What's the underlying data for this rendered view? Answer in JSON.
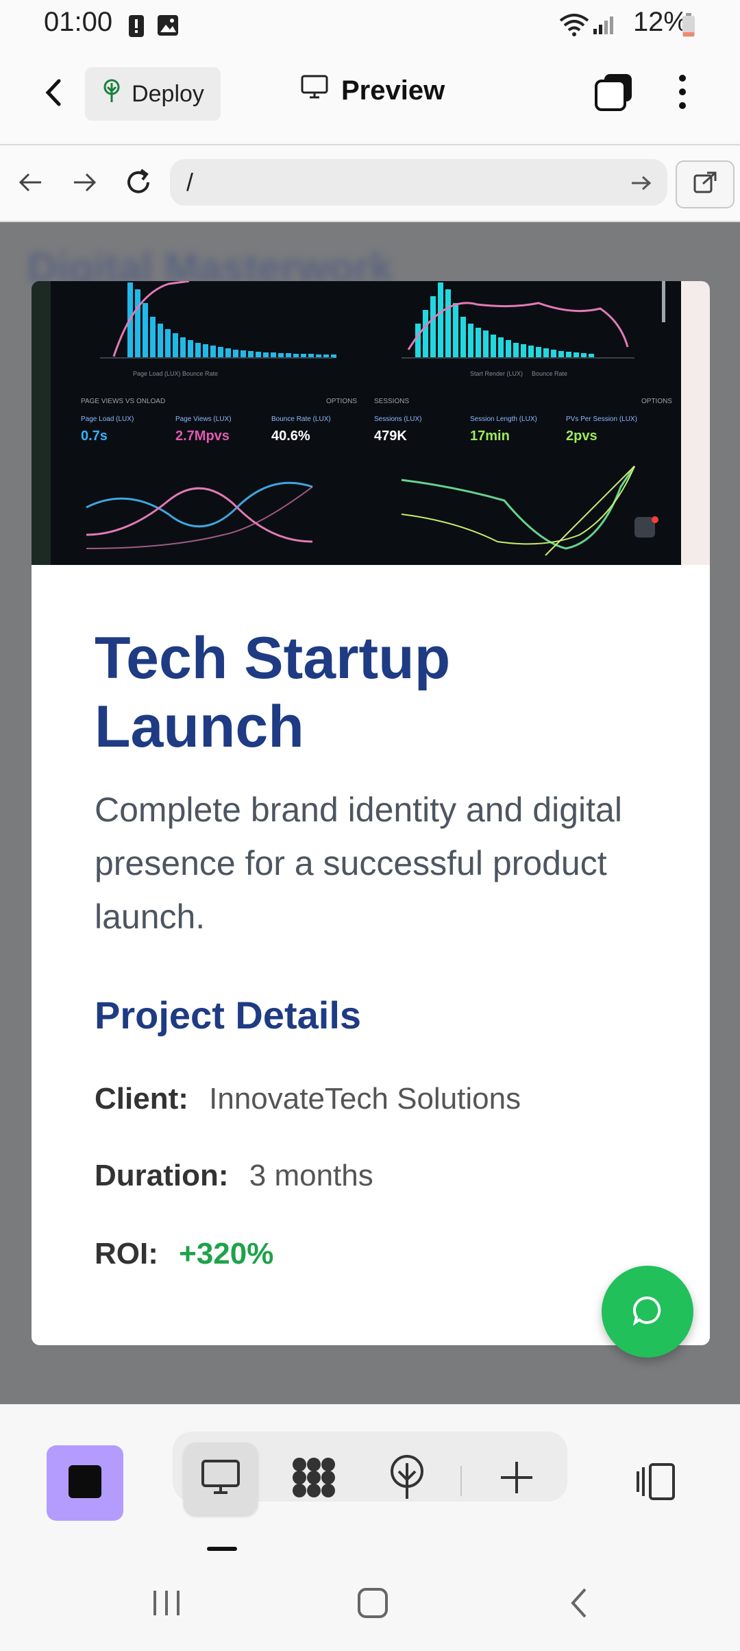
{
  "status_bar": {
    "time": "01:00",
    "battery": "12%",
    "icons": [
      "alert-icon",
      "image-icon",
      "wifi-icon",
      "signal-icon",
      "battery-icon"
    ]
  },
  "toolbar": {
    "deploy_label": "Deploy",
    "preview_label": "Preview",
    "icons": [
      "back-arrow-icon",
      "deploy-tree-icon",
      "monitor-icon",
      "window-stack-icon",
      "more-vert-icon"
    ]
  },
  "browser": {
    "url": "/",
    "icons": [
      "nav-back-icon",
      "nav-forward-icon",
      "refresh-icon",
      "go-arrow-icon",
      "open-external-icon"
    ]
  },
  "page": {
    "blurred_heading": "Digital Masterwork"
  },
  "modal": {
    "title": "Tech Startup Launch",
    "description": "Complete brand identity and digital presence for a successful product launch.",
    "details_heading": "Project Details",
    "client_label": "Client:",
    "client_value": "InnovateTech Solutions",
    "duration_label": "Duration:",
    "duration_value": "3 months",
    "roi_label": "ROI:",
    "roi_value": "+320%"
  },
  "hero_dashboard": {
    "panel_titles": [
      "PAGE VIEWS VS ONLOAD",
      "SESSIONS"
    ],
    "options_label": "OPTIONS",
    "metrics": [
      {
        "label": "Page Load (LUX)",
        "value": "0.7s",
        "color": "#35b2ff"
      },
      {
        "label": "Page Views (LUX)",
        "value": "2.7Mpvs",
        "color": "#e05ab0"
      },
      {
        "label": "Bounce Rate (LUX)",
        "value": "40.6%",
        "color": "#ffffff"
      },
      {
        "label": "Sessions (LUX)",
        "value": "479K",
        "color": "#ffffff"
      },
      {
        "label": "Session Length (LUX)",
        "value": "17min",
        "color": "#9eeb5a"
      },
      {
        "label": "PVs Per Session (LUX)",
        "value": "2pvs",
        "color": "#9eeb5a"
      }
    ],
    "legend_left": [
      "Page Load (LUX)",
      "Bounce Rate"
    ],
    "legend_right": [
      "Start Render (LUX)",
      "Bounce Rate"
    ]
  },
  "bottom_toolbar": {
    "icons": [
      "app-square-icon",
      "desktop-icon",
      "components-icon",
      "deploy-icon",
      "add-icon",
      "panel-toggle-icon"
    ]
  },
  "system_nav": {
    "icons": [
      "recents-icon",
      "home-icon",
      "back-icon"
    ]
  }
}
